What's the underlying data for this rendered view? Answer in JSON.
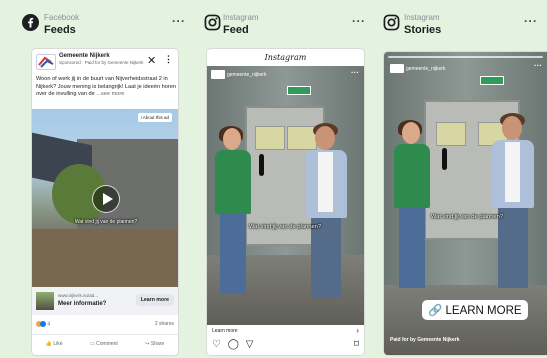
{
  "columns": {
    "facebook": {
      "platform": "Facebook",
      "placement": "Feeds",
      "more": "···"
    },
    "instagram_feed": {
      "platform": "Instagram",
      "placement": "Feed",
      "more": "···"
    },
    "instagram_stories": {
      "platform": "Instagram",
      "placement": "Stories",
      "more": "···"
    }
  },
  "fb_ad": {
    "page_name": "Gemeente Nijkerk",
    "sponsored": "Sponsored · Paid for by Gemeente Nijkerk",
    "close": "✕",
    "dots": "⋮",
    "text": "Woon of werk jij in de buurt van Nijverheidsstraat 2 in Nijkerk? Jouw mening is belangrijk! Laat je ideeën horen over de invulling van de",
    "see_more": "...see more",
    "about": "i About this ad",
    "caption": "Wat vind jij van de plannen?",
    "domain": "www.nijkerk.nu/ad...",
    "headline": "Meer informatie?",
    "learn_more": "Learn more",
    "reactions_count": "4",
    "shares": "2 shares",
    "like": "Like",
    "comment": "Comment",
    "share": "Share"
  },
  "ig_feed": {
    "wordmark": "Instagram",
    "account": "gemeente_nijkerk",
    "dots": "···",
    "caption": "Wat vind jij van de plannen?",
    "learn_more": "Learn more",
    "chevron": "›",
    "icons": "♡ ◯ ▽",
    "save": "⌑"
  },
  "ig_story": {
    "account": "gemeente_nijkerk",
    "dots": "···",
    "caption": "Wat vind jij van de plannen?",
    "learn_more": "🔗 LEARN MORE",
    "paid_for": "Paid for by Gemeente Nijkerk"
  },
  "colors": {
    "background": "#e4f2e0",
    "facebook_blue": "#1877f2",
    "green_shirt": "#2f8a4e"
  }
}
